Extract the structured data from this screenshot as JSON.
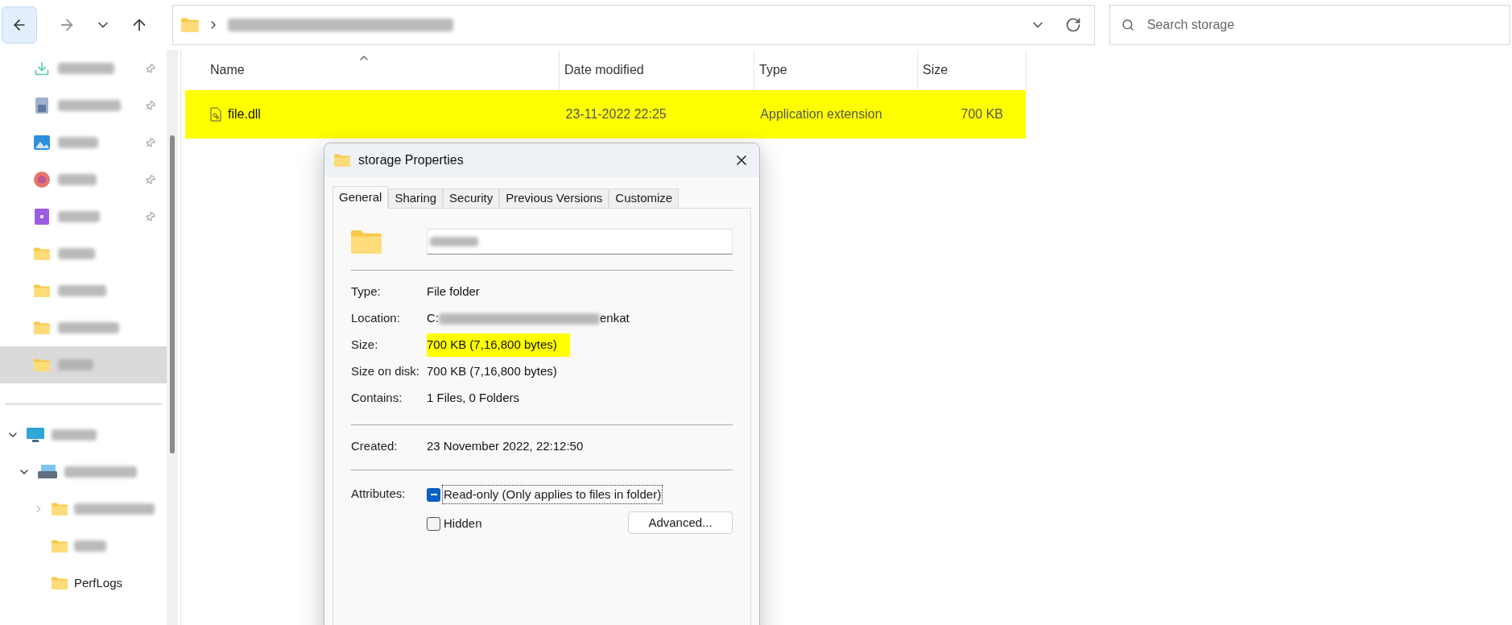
{
  "toolbar": {
    "back_button": {
      "highlighted": true
    }
  },
  "search": {
    "placeholder": "Search storage"
  },
  "sidebar": {
    "items": [
      {
        "kind": "download",
        "pinned": true,
        "selected": false
      },
      {
        "kind": "documents",
        "pinned": true,
        "selected": false
      },
      {
        "kind": "pictures",
        "pinned": true,
        "selected": false
      },
      {
        "kind": "music",
        "pinned": true,
        "selected": false
      },
      {
        "kind": "videos",
        "pinned": true,
        "selected": false
      },
      {
        "kind": "folder",
        "pinned": false,
        "selected": false
      },
      {
        "kind": "folder",
        "pinned": false,
        "selected": false
      },
      {
        "kind": "folder",
        "pinned": false,
        "selected": false
      },
      {
        "kind": "folder",
        "pinned": false,
        "selected": true
      }
    ],
    "tree": [
      {
        "kind": "pc",
        "expanded": true,
        "children": [
          {
            "kind": "drive",
            "expanded": true,
            "children": [
              {
                "kind": "folder",
                "expanded": false
              },
              {
                "kind": "folder"
              },
              {
                "kind": "folder",
                "label": "PerfLogs"
              }
            ]
          }
        ]
      }
    ]
  },
  "table": {
    "columns": [
      {
        "label": "Name",
        "sorted": true
      },
      {
        "label": "Date modified",
        "sorted": false
      },
      {
        "label": "Type",
        "sorted": false
      },
      {
        "label": "Size",
        "sorted": false
      }
    ],
    "rows": [
      {
        "name": "file.dll",
        "date_modified": "23-11-2022 22:25",
        "type": "Application extension",
        "size": "700 KB",
        "highlighted": true
      }
    ]
  },
  "dialog": {
    "title": "storage Properties",
    "tabs": [
      {
        "label": "General",
        "selected": true
      },
      {
        "label": "Sharing",
        "selected": false
      },
      {
        "label": "Security",
        "selected": false
      },
      {
        "label": "Previous Versions",
        "selected": false
      },
      {
        "label": "Customize",
        "selected": false
      }
    ],
    "sections": [
      [
        {
          "label": "Type:",
          "value": "File folder",
          "highlighted": false
        },
        {
          "label": "Location:",
          "value_parts": [
            "C:",
            "enkat"
          ],
          "highlighted": false
        },
        {
          "label": "Size:",
          "value": "700 KB (7,16,800 bytes)",
          "highlighted": true
        },
        {
          "label": "Size on disk:",
          "value": "700 KB (7,16,800 bytes)",
          "highlighted": false
        },
        {
          "label": "Contains:",
          "value": "1 Files, 0 Folders",
          "highlighted": false
        }
      ],
      [
        {
          "label": "Created:",
          "value": "23 November 2022, 22:12:50",
          "highlighted": false
        }
      ]
    ],
    "attributes": {
      "label": "Attributes:",
      "checkboxes": [
        {
          "label": "Read-only (Only applies to files in folder)",
          "indeterminate": true,
          "focused": true
        },
        {
          "label": "Hidden",
          "indeterminate": false,
          "focused": false
        }
      ]
    },
    "advanced_button": "Advanced..."
  }
}
